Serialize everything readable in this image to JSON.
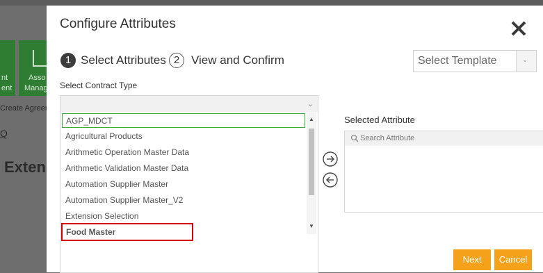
{
  "background": {
    "tile1_lines": [
      "nt",
      "ent"
    ],
    "tile2_lines": [
      "Asso",
      "Manag"
    ],
    "breadcrumb": "Create Agreeme",
    "link": "Q",
    "heading": "Exten"
  },
  "modal": {
    "title": "Configure Attributes",
    "steps": [
      {
        "number": "1",
        "label": "Select Attributes"
      },
      {
        "number": "2",
        "label": "View and Confirm"
      }
    ],
    "template_select": {
      "value": "Select Template"
    },
    "contract_type_label": "Select Contract Type",
    "contract_type_value": "",
    "contract_list": [
      "AGP_MDCT",
      "Agricultural Products",
      "Arithmetic Operation Master Data",
      "Arithmetic Validation Master Data",
      "Automation Supplier Master",
      "Automation Supplier Master_V2",
      "Extension Selection",
      "Food Master"
    ],
    "selected_attribute_label": "Selected Attribute",
    "search_placeholder": "Search Attribute",
    "buttons": {
      "next": "Next",
      "cancel": "Cancel"
    }
  },
  "colors": {
    "accent_button": "#f5a21a",
    "selected_border": "#3caa3c",
    "highlight_border": "#d60000",
    "tile_green": "#2e7d32"
  },
  "icons": [
    "close-icon",
    "chevron-down-icon",
    "search-icon",
    "arrow-right-circle-icon",
    "arrow-left-circle-icon"
  ]
}
